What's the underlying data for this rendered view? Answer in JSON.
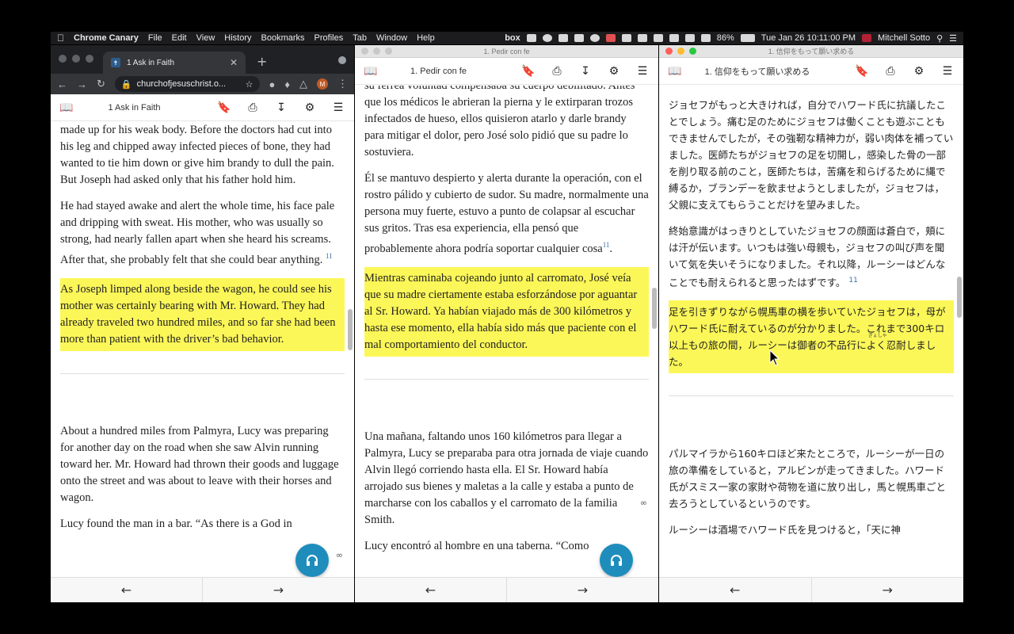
{
  "menubar": {
    "apple": "",
    "app_name": "Chrome Canary",
    "items": [
      "File",
      "Edit",
      "View",
      "History",
      "Bookmarks",
      "Profiles",
      "Tab",
      "Window",
      "Help"
    ],
    "box": "box",
    "battery": "86%",
    "datetime": "Tue Jan 26  10:11:00 PM",
    "user": "Mitchell Sotto"
  },
  "window1": {
    "tab_title": "1 Ask in Faith",
    "url": "churchofjesuschrist.o...",
    "avatar": "M",
    "reader_title": "1 Ask in Faith",
    "paragraphs": [
      "made up for his weak body. Before the doctors had cut into his leg and chipped away infected pieces of bone, they had wanted to tie him down or give him brandy to dull the pain. But Joseph had asked only that his father hold him.",
      "He had stayed awake and alert the whole time, his face pale and dripping with sweat. His mother, who was usually so strong, had nearly fallen apart when she heard his screams. After that, she probably felt that she could bear anything."
    ],
    "footnote": "11",
    "highlight": "As Joseph limped along beside the wagon, he could see his mother was certainly bearing with Mr. Howard. They had already traveled two hundred miles, and so far she had been more than patient with the driver’s bad behavior.",
    "after": [
      "About a hundred miles from Palmyra, Lucy was preparing for another day on the road when she saw Alvin running toward her. Mr. Howard had thrown their goods and luggage onto the street and was about to leave with their horses and wagon.",
      "Lucy found the man in a bar. “As there is a God in"
    ]
  },
  "window2": {
    "window_title": "1. Pedir con fe",
    "reader_title": "1. Pedir con fe",
    "paragraphs": [
      "su férrea voluntad compensaba su cuerpo debilitado. Antes que los médicos le abrieran la pierna y le extirparan trozos infectados de hueso, ellos quisieron atarlo y darle brandy para mitigar el dolor, pero José solo pidió que su padre lo sostuviera.",
      "Él se mantuvo despierto y alerta durante la operación, con el rostro pálido y cubierto de sudor. Su madre, normalmente una persona muy fuerte, estuvo a punto de colapsar al escuchar sus gritos. Tras esa experiencia, ella pensó que probablemente ahora podría soportar cualquier cosa"
    ],
    "footnote": "11",
    "highlight": "Mientras caminaba cojeando junto al carromato, José veía que su madre ciertamente estaba esforzándose por aguantar al Sr. Howard. Ya habían viajado más de 300 kilómetros y hasta ese momento, ella había sido más que paciente con el mal comportamiento del conductor.",
    "after": [
      "Una mañana, faltando unos 160 kilómetros para llegar a Palmyra, Lucy se preparaba para otra jornada de viaje cuando Alvin llegó corriendo hasta ella. El Sr. Howard había arrojado sus bienes y maletas a la calle y estaba a punto de marcharse con los caballos y el carromato de la familia Smith.",
      "Lucy encontró al hombre en una taberna. “Como"
    ]
  },
  "window3": {
    "window_title": "1.  信仰をもって願い求める",
    "reader_title": "1.  信仰をもって願い求める",
    "paragraphs": [
      "ジョセフがもっと大きければ，自分でハワード氏に抗議したことでしょう。痛む足のためにジョセフは働くことも遊ぶこともできませんでしたが，その強靭な精神力が，弱い肉体を補っていました。医師たちがジョセフの足を切開し，感染した骨の一部を削り取る前のこと，医師たちは，苦痛を和らげるために縄で縛るか，ブランデーを飲ませようとしましたが，ジョセフは，父親に支えてもらうことだけを望みました。",
      "終始意識がはっきりとしていたジョセフの顔面は蒼白で，頬には汗が伝います。いつもは強い母親も，ジョセフの叫び声を聞いて気を失いそうになりました。それ以降，ルーシーはどんなことでも耐えられると思ったはずです。"
    ],
    "footnote": "11",
    "highlight": "足を引きずりながら幌馬車の横を歩いていたジョセフは，母がハワード氏に耐えているのが分かりました。これまで300キロ以上もの旅の間，ルーシーは御者の不品行によく忍耐しました。",
    "after": [
      "パルマイラから160キロほど来たところで，ルーシーが一日の旅の準備をしていると，アルビンが走ってきました。ハワード氏がスミス一家の家財や荷物を道に放り出し，馬と幌馬車ごと去ろうとしているというのです。",
      "ルーシーは酒場でハワード氏を見つけると，「天に神"
    ]
  },
  "ruby": "ぎょしゃ",
  "infinity": "∞",
  "colors": {
    "highlight": "#fcf758",
    "fab": "#1f8dbc",
    "footnote": "#3a6ea5"
  }
}
